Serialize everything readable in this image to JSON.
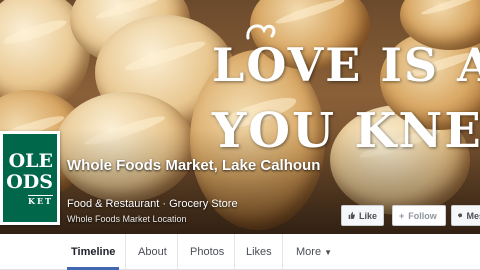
{
  "cover": {
    "slogan_line1": "LOVE IS AL",
    "slogan_line2": "YOU KNEA"
  },
  "profile": {
    "logo_line1": "OLE",
    "logo_line2": "ODS",
    "logo_line3": "KET",
    "name": "Whole Foods Market, Lake Calhoun",
    "categories": "Food & Restaurant · Grocery Store",
    "location_label": "Whole Foods Market Location"
  },
  "actions": {
    "like_label": "Like",
    "follow_label": "Follow",
    "message_label": "Mes"
  },
  "nav": {
    "tabs": [
      {
        "label": "Timeline"
      },
      {
        "label": "About"
      },
      {
        "label": "Photos"
      },
      {
        "label": "Likes"
      },
      {
        "label": "More"
      }
    ]
  },
  "colors": {
    "brand_green": "#00674b",
    "accent_blue": "#4267b2"
  },
  "icons": {
    "like": "thumbs-up-icon",
    "follow": "plus-icon",
    "message": "chat-bubble-icon",
    "more": "caret-down-icon"
  }
}
